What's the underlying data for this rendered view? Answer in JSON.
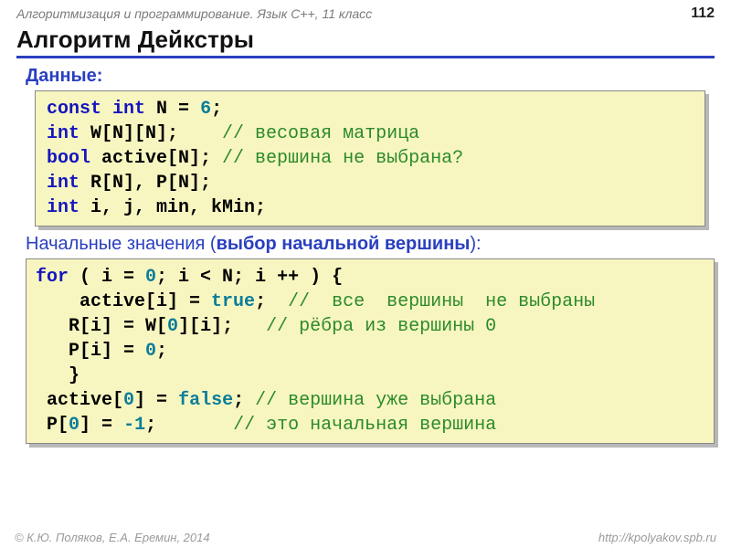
{
  "header": {
    "course": "Алгоритмизация и программирование. Язык C++, 11 класс",
    "page": "112"
  },
  "title": "Алгоритм Дейкстры",
  "section1": {
    "label": "Данные:"
  },
  "code1": {
    "l1_kw1": "const",
    "l1_kw2": "int",
    "l1_rest": " N = ",
    "l1_num": "6",
    "l1_semi": ";",
    "l2_kw": "int",
    "l2_rest": " W[N][N];    ",
    "l2_cm": "// весовая матрица",
    "l3_kw": "bool",
    "l3_rest": " active[N]; ",
    "l3_cm": "// вершина не выбрана?",
    "l4_kw": "int",
    "l4_rest": " R[N], P[N];",
    "l5_kw": "int",
    "l5_rest": " i, j, min, kMin;"
  },
  "section2": {
    "plain": "Начальные значения (",
    "bold": "выбор начальной вершины",
    "tail": "):"
  },
  "code2": {
    "l1_kw": "for",
    "l1_a": " ( i = ",
    "l1_n1": "0",
    "l1_b": "; i < N; i ++ ) {",
    "l2_a": "    active[i] = ",
    "l2_lit": "true",
    "l2_b": ";  ",
    "l2_cm": "//  все  вершины  не выбраны",
    "l3_a": "   R[i] = W[",
    "l3_n": "0",
    "l3_b": "][i];   ",
    "l3_cm": "// рёбра из вершины 0",
    "l4_a": "   P[i] = ",
    "l4_n": "0",
    "l4_b": ";",
    "l5": "   }",
    "l6_a": " active[",
    "l6_n": "0",
    "l6_b": "] = ",
    "l6_lit": "false",
    "l6_c": "; ",
    "l6_cm": "// вершина уже выбрана",
    "l7_a": " P[",
    "l7_n1": "0",
    "l7_b": "] = ",
    "l7_n2": "-1",
    "l7_c": ";       ",
    "l7_cm": "// это начальная вершина"
  },
  "footer": {
    "left": "© К.Ю. Поляков, Е.А. Еремин, 2014",
    "right": "http://kpolyakov.spb.ru"
  }
}
